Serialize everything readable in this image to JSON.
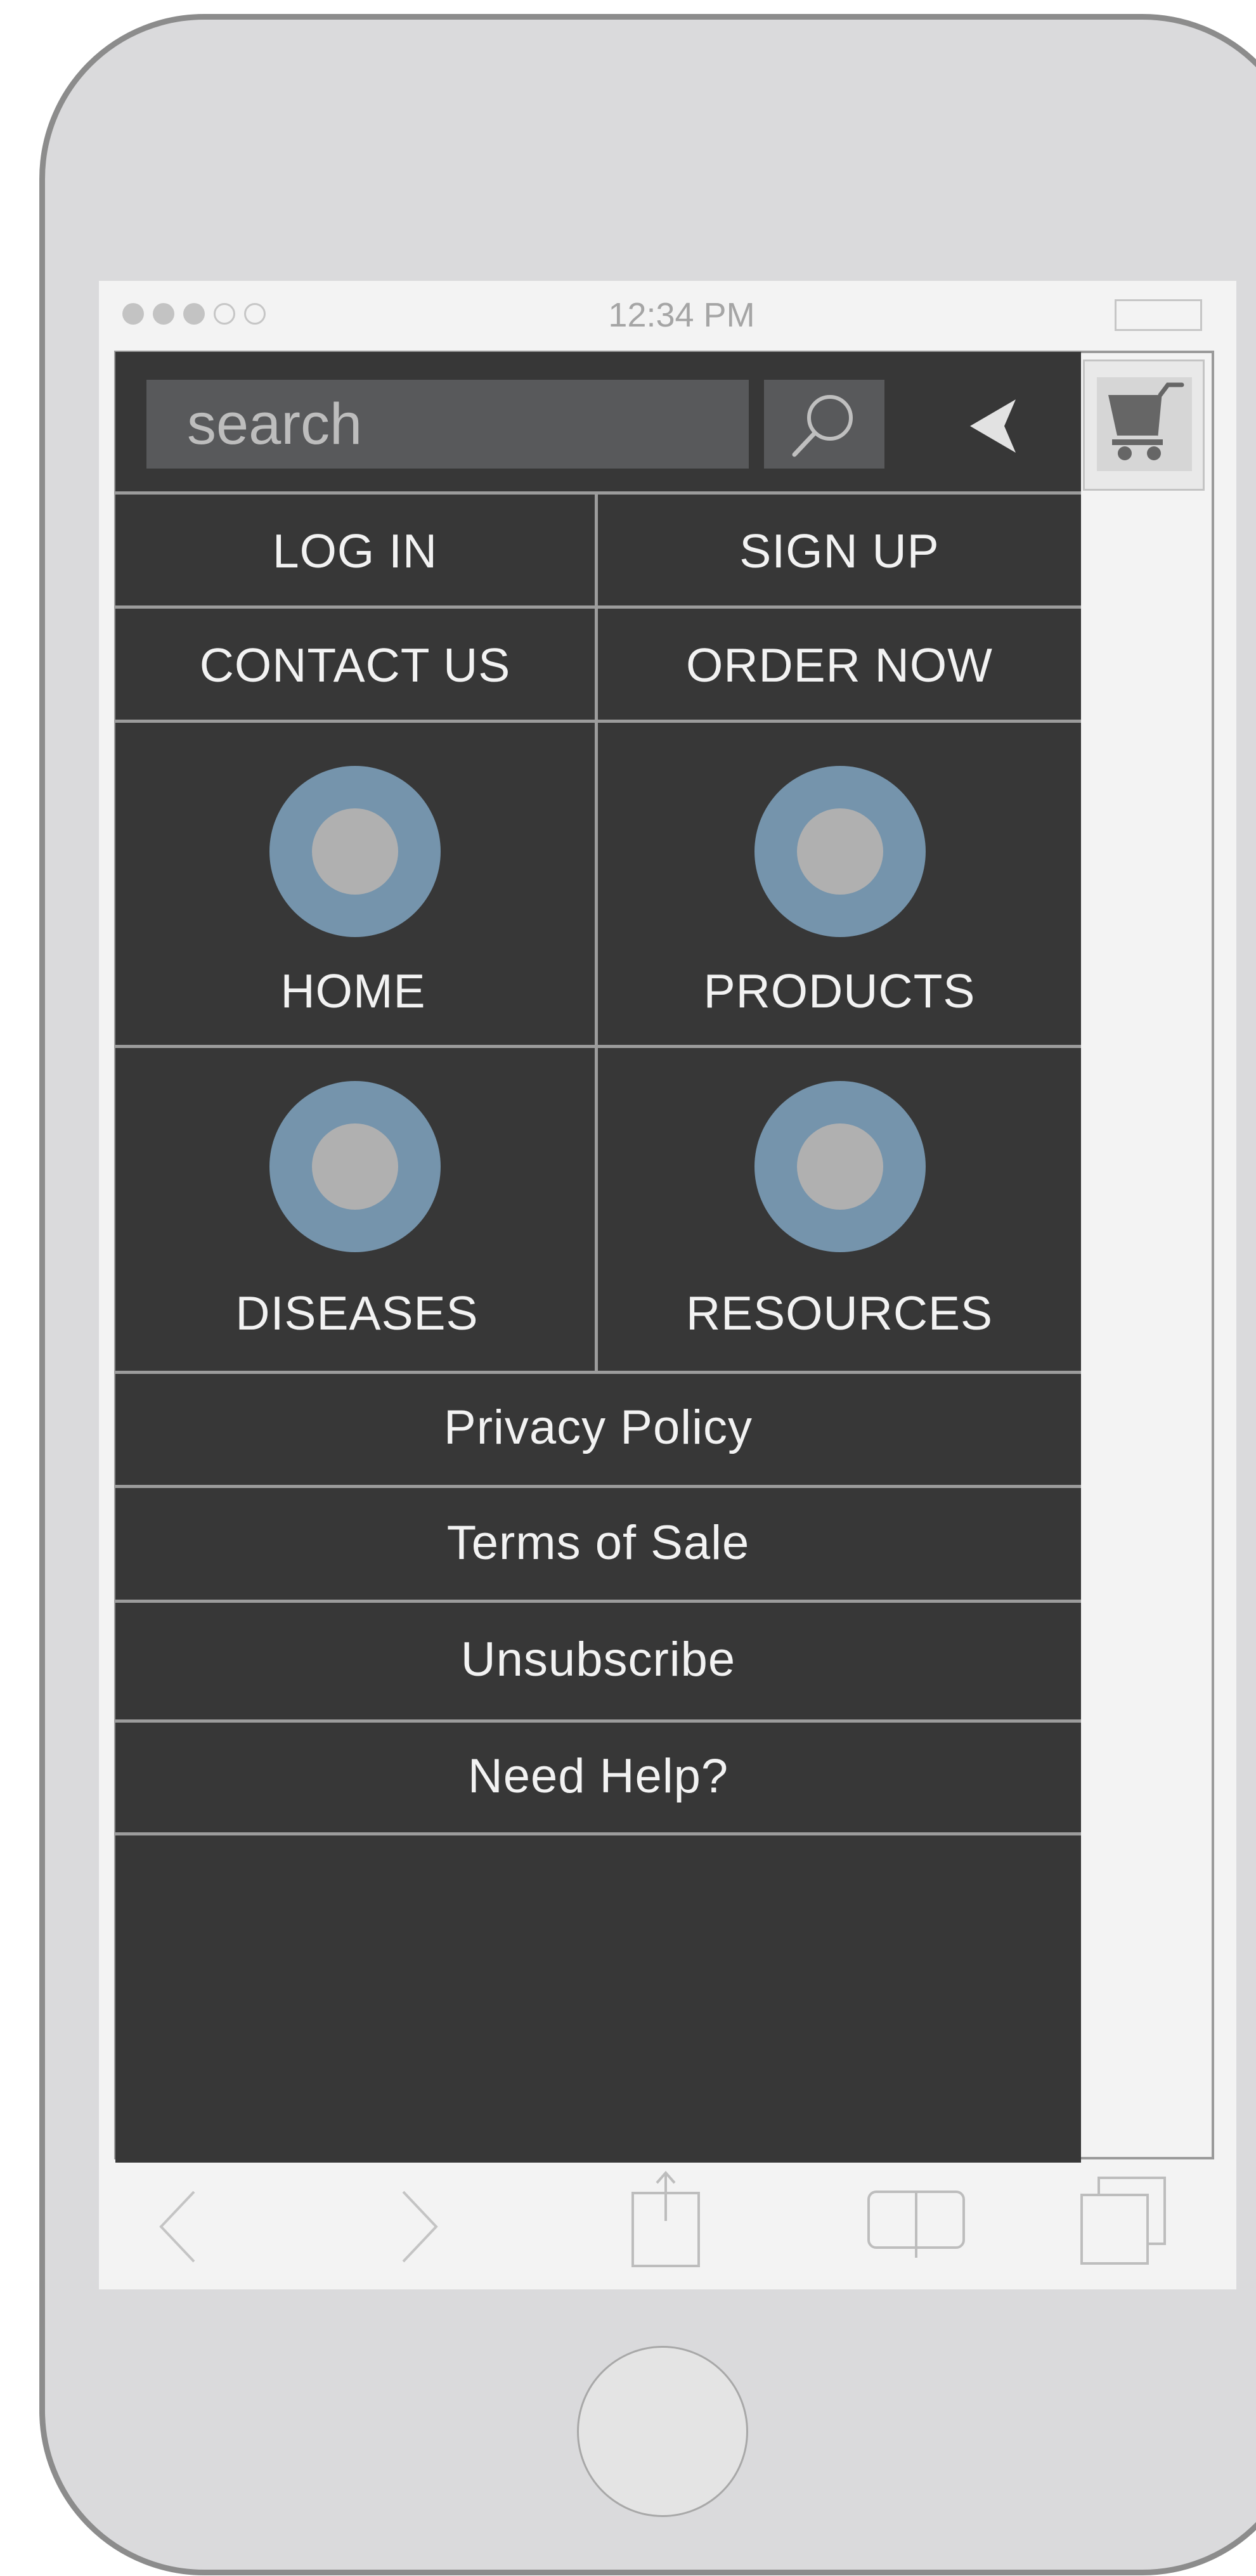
{
  "status_bar": {
    "time": "12:34 PM",
    "signal_dots": [
      true,
      true,
      true,
      false,
      false
    ]
  },
  "header": {
    "search_placeholder": "search",
    "search_icon": "search-icon",
    "back_icon": "chevron-left-icon",
    "cart_icon": "shopping-cart-icon"
  },
  "menu": {
    "account_buttons": [
      {
        "label": "LOG IN"
      },
      {
        "label": "SIGN UP"
      },
      {
        "label": "CONTACT US"
      },
      {
        "label": "ORDER NOW"
      }
    ],
    "nav_items": [
      {
        "label": "HOME"
      },
      {
        "label": "PRODUCTS"
      },
      {
        "label": "DISEASES"
      },
      {
        "label": "RESOURCES"
      }
    ],
    "links": [
      {
        "label": "Privacy Policy"
      },
      {
        "label": "Terms of Sale"
      },
      {
        "label": "Unsubscribe"
      },
      {
        "label": "Need Help?"
      }
    ]
  },
  "toolbar": {
    "icons": [
      "back-arrow-icon",
      "forward-arrow-icon",
      "share-icon",
      "bookmarks-icon",
      "tabs-icon"
    ]
  },
  "colors": {
    "menu_background": "#373737",
    "nav_icon_ring": "#7594ac",
    "nav_icon_center": "#b0b0b0",
    "phone_body": "#dadadc",
    "screen_background": "#f3f3f3"
  }
}
